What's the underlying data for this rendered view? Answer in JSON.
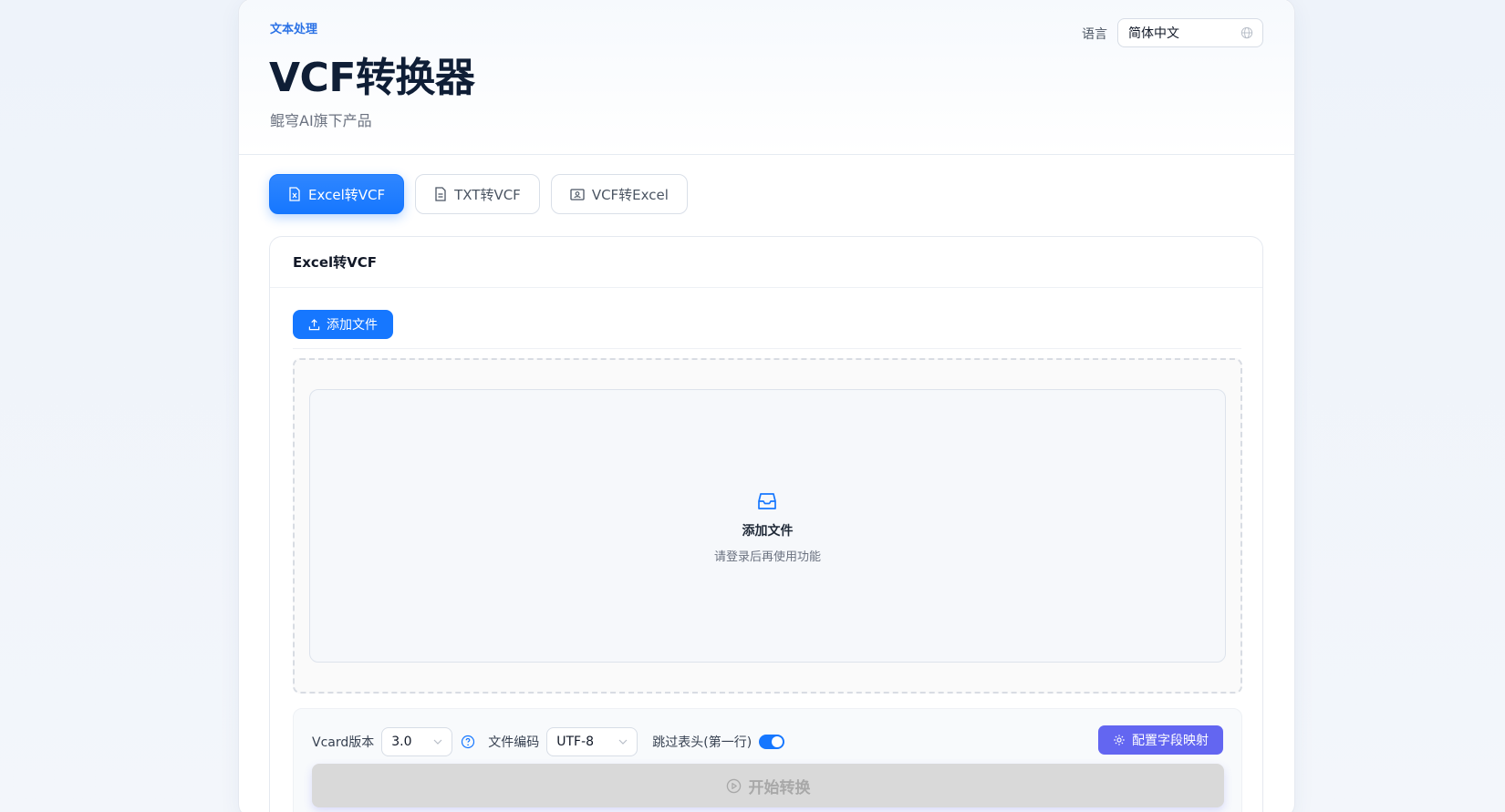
{
  "header": {
    "category": "文本处理",
    "title": "VCF转换器",
    "subtitle": "鲲穹AI旗下产品",
    "language_label": "语言",
    "language_value": "简体中文"
  },
  "tabs": [
    {
      "label": "Excel转VCF",
      "active": true,
      "icon": "excel-file-icon"
    },
    {
      "label": "TXT转VCF",
      "active": false,
      "icon": "text-file-icon"
    },
    {
      "label": "VCF转Excel",
      "active": false,
      "icon": "contact-card-icon"
    }
  ],
  "panel": {
    "title": "Excel转VCF",
    "add_button": "添加文件",
    "dropzone": {
      "icon": "inbox-icon",
      "title": "添加文件",
      "description": "请登录后再使用功能"
    },
    "options": {
      "vcard_label": "Vcard版本",
      "vcard_value": "3.0",
      "encoding_label": "文件编码",
      "encoding_value": "UTF-8",
      "skip_header_label": "跳过表头(第一行)",
      "skip_header_on": true,
      "config_button": "配置字段映射",
      "start_button": "开始转换"
    }
  },
  "colors": {
    "primary": "#1677ff",
    "accent": "#6366f1",
    "title": "#0f1e36",
    "disabled": "#d9d9d9"
  }
}
